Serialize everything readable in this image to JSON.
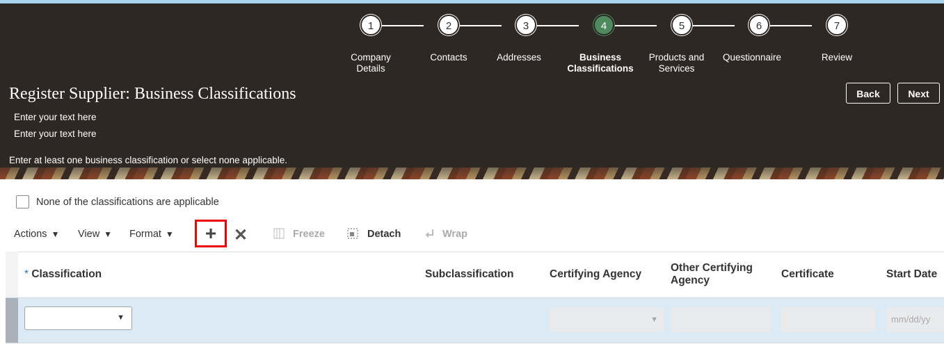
{
  "train": {
    "steps": [
      {
        "num": "1",
        "label": "Company\nDetails"
      },
      {
        "num": "2",
        "label": "Contacts"
      },
      {
        "num": "3",
        "label": "Addresses"
      },
      {
        "num": "4",
        "label": "Business\nClassifications"
      },
      {
        "num": "5",
        "label": "Products and\nServices"
      },
      {
        "num": "6",
        "label": "Questionnaire"
      },
      {
        "num": "7",
        "label": "Review"
      }
    ],
    "active_step": 4
  },
  "header": {
    "title": "Register Supplier: Business Classifications",
    "line1": "Enter your text here",
    "line2": "Enter your text here",
    "instruction": "Enter at least one business classification or select none applicable.",
    "back_label": "Back",
    "next_label": "Next"
  },
  "form": {
    "none_applicable_label": "None of the classifications are applicable"
  },
  "toolbar": {
    "actions_label": "Actions",
    "view_label": "View",
    "format_label": "Format",
    "freeze_label": "Freeze",
    "detach_label": "Detach",
    "wrap_label": "Wrap",
    "add_icon": "plus-icon",
    "delete_icon": "close-icon"
  },
  "table": {
    "columns": {
      "required_mark": "*",
      "classification": "Classification",
      "subclassification": "Subclassification",
      "certifying_agency": "Certifying Agency",
      "other_certifying_agency": "Other Certifying\nAgency",
      "certificate": "Certificate",
      "start_date": "Start Date"
    },
    "row": {
      "start_date_placeholder": "mm/dd/yy"
    }
  },
  "colors": {
    "header_bg": "#2e2824",
    "active_step": "#4e8a5e",
    "row_highlight": "#dbeaf5",
    "add_highlight": "#ee0000"
  }
}
